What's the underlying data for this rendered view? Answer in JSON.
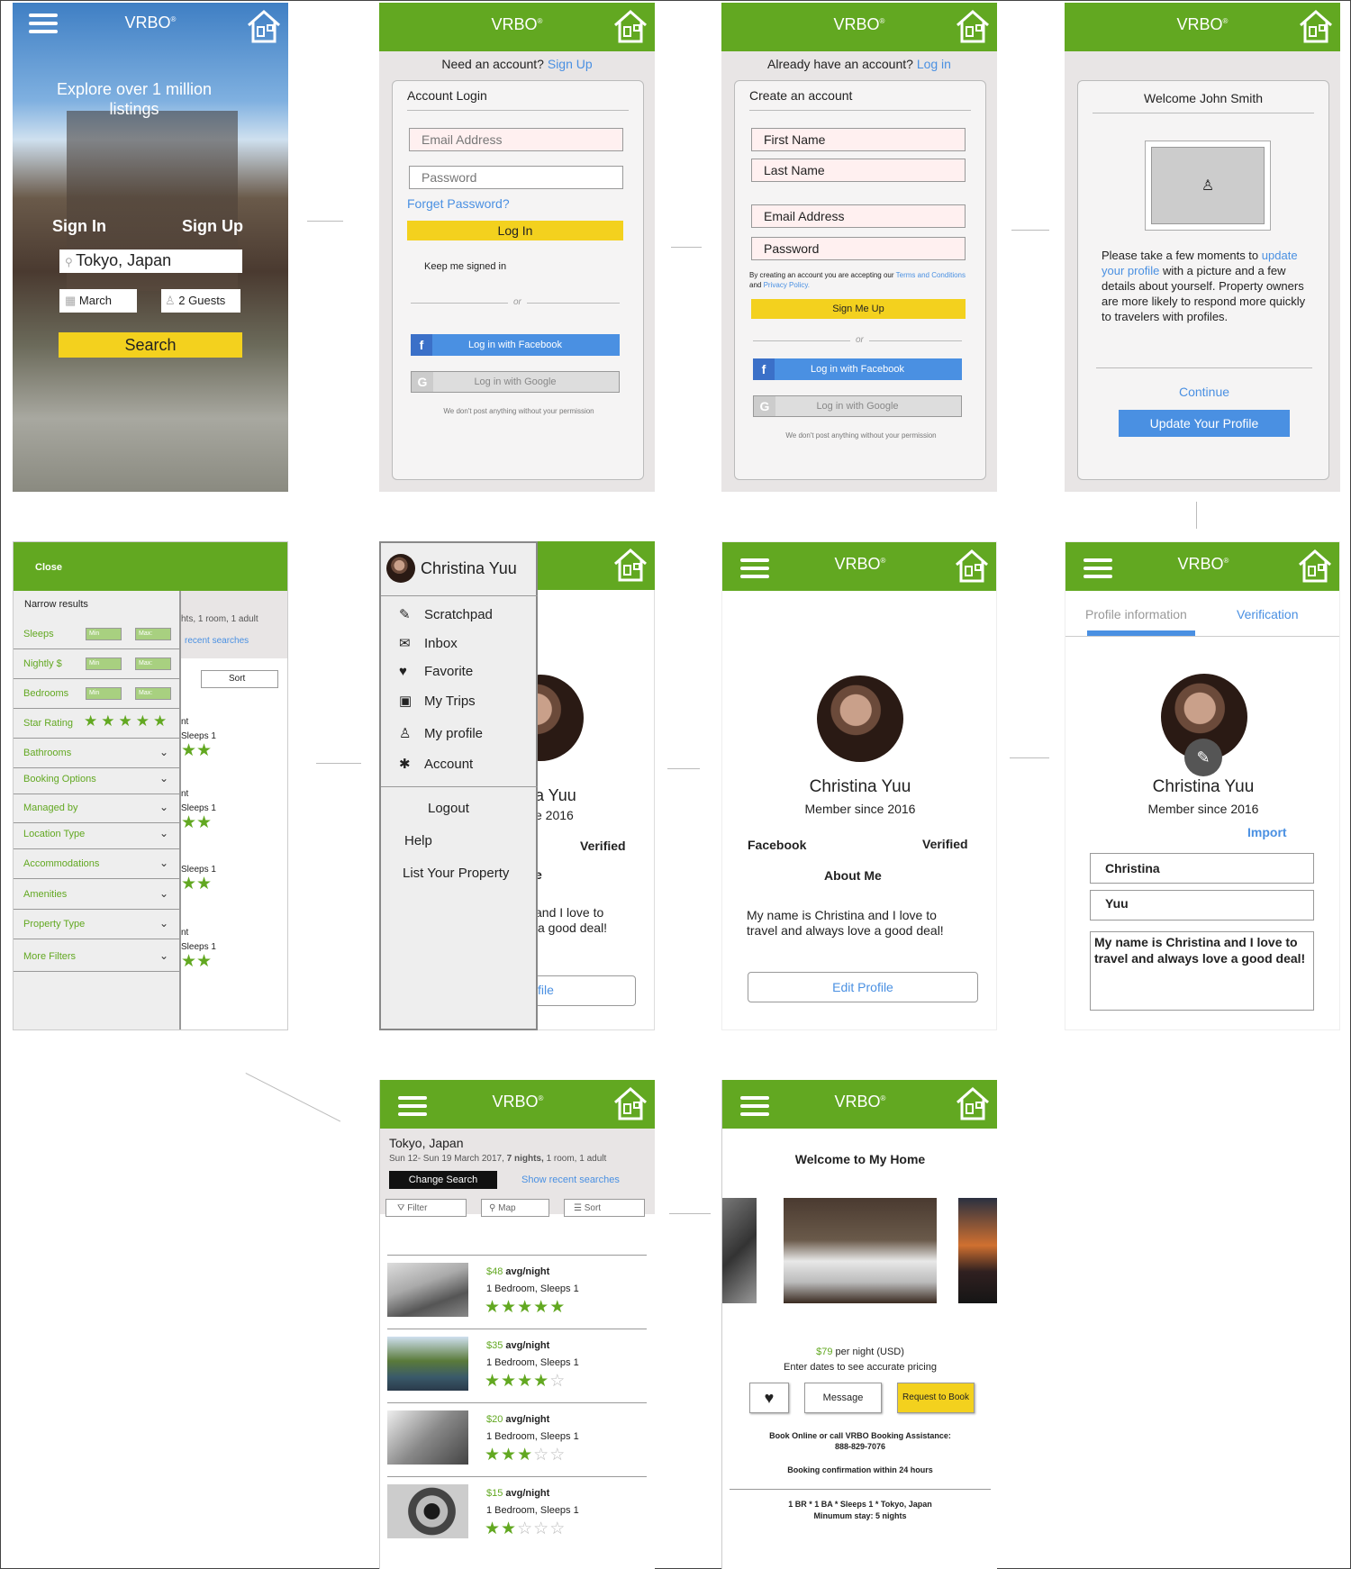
{
  "brand": {
    "name": "VRBO",
    "mark": "®"
  },
  "colors": {
    "green": "#62a821",
    "yellow": "#f3d11e",
    "blue": "#4a90e2"
  },
  "home": {
    "tagline": "Explore over 1 million listings",
    "tab_signin": "Sign In",
    "tab_signup": "Sign Up",
    "location": "Tokyo, Japan",
    "date": "March",
    "guests": "2 Guests",
    "search": "Search"
  },
  "login": {
    "prompt": "Need an account?",
    "signup_link": "Sign Up",
    "title": "Account Login",
    "email_placeholder": "Email Address",
    "password_placeholder": "Password",
    "forgot": "Forget Password?",
    "login_button": "Log In",
    "keep_signed": "Keep me signed in",
    "or": "or",
    "facebook": "Log in with Facebook",
    "google": "Log in with Google",
    "disclaimer": "We don't post anything without your permission"
  },
  "signup": {
    "prompt": "Already have an account?",
    "login_link": "Log in",
    "title": "Create an account",
    "first_name": "First Name",
    "last_name": "Last Name",
    "email": "Email Address",
    "password": "Password",
    "terms_prefix": "By creating an account you are accepting our",
    "terms_link": "Terms and Conditions",
    "and": "and",
    "privacy_link": "Privacy Policy.",
    "signup_button": "Sign Me Up",
    "or": "or",
    "facebook": "Log in with Facebook",
    "google": "Log in with Google",
    "disclaimer": "We don't post anything without your permission"
  },
  "welcome": {
    "title": "Welcome John Smith",
    "text_prefix": "Please take a few moments to",
    "text_link": "update your profile",
    "text_suffix": "with a picture and a few details about yourself. Property owners are more likely to respond more quickly to travelers with profiles.",
    "continue": "Continue",
    "update_button": "Update Your Profile"
  },
  "filters": {
    "close": "Close",
    "title": "Narrow results",
    "min": "Min",
    "max": "Max:",
    "sleeps": "Sleeps",
    "nightly": "Nightly $",
    "bedrooms": "Bedrooms",
    "star_rating": "Star Rating",
    "rows": [
      "Bathrooms",
      "Booking Options",
      "Managed by",
      "Location Type",
      "Accommodations",
      "Amenities",
      "Property Type",
      "More Filters"
    ],
    "bg_summary": "hts, 1 room, 1 adult",
    "bg_recent": "recent searches",
    "bg_sort": "Sort",
    "bg_item": "nt",
    "bg_sleeps": "Sleeps 1"
  },
  "menu": {
    "user": "Christina Yuu",
    "items": [
      "Scratchpad",
      "Inbox",
      "Favorite",
      "My Trips",
      "My profile",
      "Account"
    ],
    "secondary": [
      "Logout",
      "Help",
      "List Your Property"
    ],
    "bg_name": "a Yuu",
    "bg_since": "e 2016",
    "bg_verified": "Verified",
    "bg_e": "e",
    "bg_text1": "and I love to",
    "bg_text2": "a good deal!",
    "bg_button": "file"
  },
  "profile": {
    "name": "Christina Yuu",
    "since": "Member since 2016",
    "facebook": "Facebook",
    "verified": "Verified",
    "about_title": "About Me",
    "about": "My name is Christina and I love to travel and always love a good deal!",
    "edit_button": "Edit Profile"
  },
  "edit": {
    "tab_info": "Profile information",
    "tab_verify": "Verification",
    "name": "Christina Yuu",
    "since": "Member since 2016",
    "import": "Import",
    "first": "Christina",
    "last": "Yuu",
    "bio": "My name is Christina and I love to travel and always love a good deal!"
  },
  "results": {
    "city": "Tokyo, Japan",
    "dates": "Sun 12- Sun 19 March 2017,",
    "nights": "7 nights,",
    "rest": "1 room, 1 adult",
    "change": "Change Search",
    "recent": "Show recent searches",
    "filter": "Filter",
    "map": "Map",
    "sort": "Sort",
    "listings": [
      {
        "price": "$48",
        "unit": "avg/night",
        "beds": "1 Bedroom, Sleeps 1",
        "rating": 5
      },
      {
        "price": "$35",
        "unit": "avg/night",
        "beds": "1 Bedroom, Sleeps 1",
        "rating": 4
      },
      {
        "price": "$20",
        "unit": "avg/night",
        "beds": "1 Bedroom, Sleeps 1",
        "rating": 3
      },
      {
        "price": "$15",
        "unit": "avg/night",
        "beds": "1 Bedroom, Sleeps 1",
        "rating": 2
      }
    ]
  },
  "detail": {
    "title": "Welcome to My Home",
    "price": "$79",
    "price_unit": "per night (USD)",
    "enter_dates": "Enter dates to see accurate pricing",
    "message": "Message",
    "request": "Request to Book",
    "assist": "Book Online or call VRBO Booking Assistance:",
    "phone": "888-829-7076",
    "confirm": "Booking confirmation within 24 hours",
    "specs": "1 BR * 1 BA * Sleeps 1 * Tokyo, Japan",
    "min_stay": "Minumum stay: 5 nights"
  }
}
